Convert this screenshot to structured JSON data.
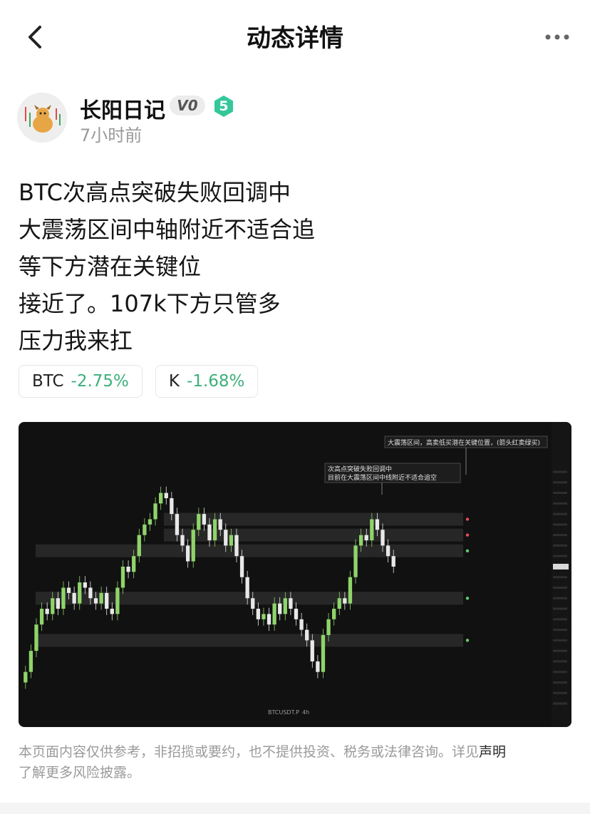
{
  "header": {
    "title": "动态详情",
    "back_icon": "chevron-left-icon",
    "more_icon": "more-dots-icon"
  },
  "author": {
    "name": "长阳日记",
    "vip_badge": "V0",
    "level": "5",
    "time": "7小时前",
    "avatar_icon": "avatar-cartoon-bull"
  },
  "post": {
    "lines": [
      "BTC次高点突破失败回调中",
      "大震荡区间中轴附近不适合追",
      "等下方潜在关键位",
      "接近了。107k下方只管多",
      "压力我来扛"
    ]
  },
  "tickers": [
    {
      "symbol": "BTC",
      "change": "-2.75%"
    },
    {
      "symbol": "K",
      "change": "-1.68%"
    }
  ],
  "colors": {
    "positive": "#3db07a",
    "chart_bg": "#111111",
    "candle_up": "#8fd46a",
    "candle_down": "#e8e8e8",
    "level_badge": "#34c79a"
  },
  "chart_data": {
    "type": "candlestick",
    "symbol_label": "BTCUSDT.P",
    "interval": "4h",
    "annotation_top": "大震荡区间，高卖低买潜在关键位置，(箭头红卖绿买)",
    "annotation_mid_line1": "次高点突破失败回调中",
    "annotation_mid_line2": "目前在大震荡区间中线附近不适合追空",
    "close_series": [
      92,
      96,
      101,
      104,
      103,
      106,
      104,
      108,
      107,
      105,
      109,
      108,
      106,
      105,
      107,
      104,
      103,
      108,
      112,
      111,
      114,
      118,
      120,
      121,
      124,
      126,
      125,
      122,
      118,
      116,
      113,
      119,
      122,
      120,
      117,
      121,
      119,
      116,
      118,
      114,
      110,
      106,
      104,
      102,
      103,
      101,
      105,
      103,
      106,
      104,
      102,
      100,
      98,
      94,
      92,
      99,
      102,
      104,
      106,
      105,
      110,
      116,
      118,
      117,
      121,
      119,
      116,
      114,
      112
    ],
    "zones": [
      {
        "level": 121,
        "kind": "sell"
      },
      {
        "level": 118,
        "kind": "sell"
      },
      {
        "level": 115,
        "kind": "buy"
      },
      {
        "level": 106,
        "kind": "buy"
      },
      {
        "level": 98,
        "kind": "buy"
      }
    ]
  },
  "disclaimer": {
    "text": "本页面内容仅供参考，非招揽或要约，也不提供投资、税务或法律咨询。详见",
    "link": "声明",
    "text2": "了解更多风险披露。"
  }
}
